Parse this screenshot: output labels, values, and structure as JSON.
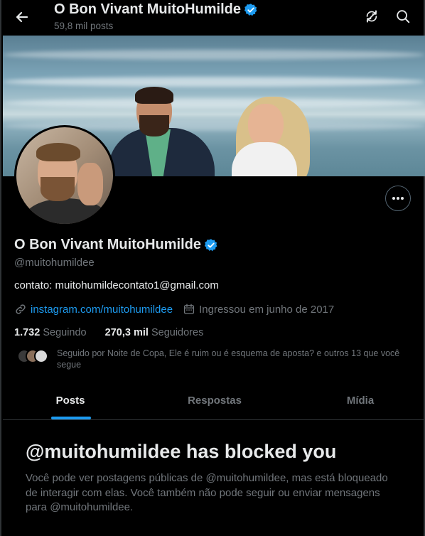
{
  "header": {
    "title": "O Bon Vivant MuitoHumilde",
    "post_count": "59,8 mil posts"
  },
  "profile": {
    "name": "O Bon Vivant MuitoHumilde",
    "handle": "@muitohumildee",
    "bio": "contato: muitohumildecontato1@gmail.com",
    "link": "instagram.com/muitohumildee",
    "joined": "Ingressou em junho de 2017",
    "following_count": "1.732",
    "following_label": "Seguindo",
    "followers_count": "270,3 mil",
    "followers_label": "Seguidores",
    "followed_by": "Seguido por Noite de Copa, Ele é ruim ou é esquema de aposta? e outros 13 que você segue"
  },
  "tabs": [
    {
      "label": "Posts",
      "active": true
    },
    {
      "label": "Respostas",
      "active": false
    },
    {
      "label": "Mídia",
      "active": false
    }
  ],
  "blocked": {
    "title": "@muitohumildee has blocked you",
    "message": "Você pode ver postagens públicas de @muitohumildee, mas está bloqueado de interagir com elas. Você também não pode seguir ou enviar mensagens para @muitohumildee."
  },
  "colors": {
    "accent": "#1d9bf0",
    "verified": "#1d9bf0",
    "background": "#000000",
    "muted_text": "#71767b"
  },
  "icons": [
    "back-arrow-icon",
    "verified-badge-icon",
    "refresh-icon",
    "search-icon",
    "more-icon",
    "link-icon",
    "calendar-icon"
  ]
}
